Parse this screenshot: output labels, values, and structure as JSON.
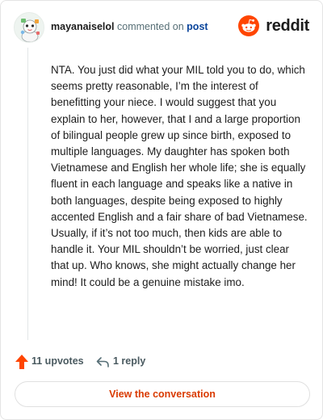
{
  "header": {
    "username": "mayanaiselol",
    "action_text": "commented on",
    "post_link": "post",
    "brand_name": "reddit",
    "avatar_icon": "user-avatar-icon",
    "brand_icon": "reddit-alien-icon"
  },
  "comment": {
    "text": "NTA. You just did what your MIL told you to do, which seems pretty reasonable, I’m the interest of benefitting your niece. I would suggest that you explain to her, however, that I and a large proportion of bilingual people grew up since birth, exposed to multiple languages. My daughter has spoken both Vietnamese and English her whole life; she is equally fluent in each language and speaks like a native in both languages, despite being exposed to highly accented English and a fair share of bad Vietnamese. Usually, if it’s not too much, then kids are able to handle it. Your MIL shouldn’t be worried, just clear that up. Who knows, she might actually change her mind! It could be a genuine mistake imo."
  },
  "actions": {
    "upvotes_label": "11 upvotes",
    "replies_label": "1 reply",
    "upvote_icon": "upvote-arrow-icon",
    "reply_icon": "reply-arrow-icon"
  },
  "cta": {
    "label": "View the conversation"
  },
  "colors": {
    "brand_orange": "#ff4500",
    "link_blue": "#0a449b",
    "cta_text": "#d93a00",
    "upvote_orange": "#ff4500"
  }
}
